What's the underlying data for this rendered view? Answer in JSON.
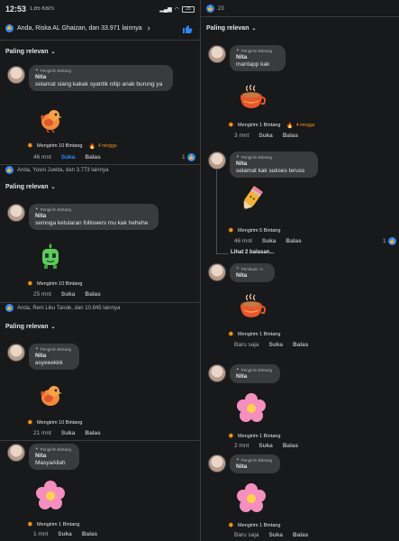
{
  "status": {
    "time": "12:53",
    "mini": "1,65 KB/S",
    "battery": "25"
  },
  "left": {
    "top_reactions": "Anda, Riska AL Ghaizan, dan 33.971 lainnya",
    "sort_label": "Paling relevan",
    "c1": {
      "badge": "Pengirim Bintang",
      "name": "Nita",
      "text": "selamat siang kakak syantik nitip anak burung ya",
      "sender": "Mengirim 10 Bintang",
      "ago": "4 minggu",
      "time": "46 mnt",
      "like": "Suka",
      "reply": "Balas",
      "count": "1"
    },
    "post2_reactions": "Anda, Yusni Juwita, dan 3.773 lainnya",
    "sort2_label": "Paling relevan",
    "c2": {
      "badge": "Pengirim Bintang",
      "name": "Nita",
      "text": "semoga ketularan followers mu kak hehehe",
      "sender": "Mengirim 10 Bintang",
      "time": "25 mnt",
      "like": "Suka",
      "reply": "Balas"
    },
    "post3_reactions": "Anda, Reni Liku Tande, dan 10.845 lainnya",
    "sort3_label": "Paling relevan",
    "c3": {
      "badge": "Pengirim Bintang",
      "name": "Nita",
      "text": "asyeeekkk",
      "sender": "Mengirim 10 Bintang",
      "time": "21 mnt",
      "like": "Suka",
      "reply": "Balas"
    },
    "c4": {
      "badge": "Pengirim Bintang",
      "name": "Nita",
      "text": "MasyaAllah",
      "sender": "Mengirim 1 Bintang",
      "time": "1 mnt",
      "like": "Suka",
      "reply": "Balas"
    }
  },
  "right": {
    "top_count": "23",
    "sort_label": "Paling relevan",
    "c1": {
      "badge": "Pengirim Bintang",
      "name": "Nita",
      "text": "mantapp kak",
      "sender": "Mengirim 1 Bintang",
      "ago": "4 minggu",
      "time": "3 mnt",
      "like": "Suka",
      "reply": "Balas"
    },
    "c2": {
      "badge": "Pengirim Bintang",
      "name": "Nita",
      "text": "selamat kak sukses teruss",
      "sender": "Mengirim 5 Bintang",
      "time": "46 mnt",
      "like": "Suka",
      "reply": "Balas",
      "count": "1"
    },
    "more_replies": "Lihat 2 balasan...",
    "c3": {
      "badge": "Pembuat +1",
      "name": "Nita",
      "sender": "Mengirim 1 Bintang",
      "time": "Baru saja",
      "like": "Suka",
      "reply": "Balas"
    },
    "c4": {
      "badge": "Pengirim Bintang",
      "name": "Nita",
      "sender": "Mengirim 1 Bintang",
      "time": "2 mnt",
      "like": "Suka",
      "reply": "Balas"
    },
    "c5": {
      "badge": "Pengirim Bintang",
      "name": "Nita",
      "sender": "Mengirim 1 Bintang",
      "time": "Baru saja",
      "like": "Suka",
      "reply": "Balas"
    }
  },
  "colors": {
    "background": "#18191a",
    "bubble": "#3a3b3c",
    "accent": "#2d88ff",
    "star": "#f7931e"
  }
}
